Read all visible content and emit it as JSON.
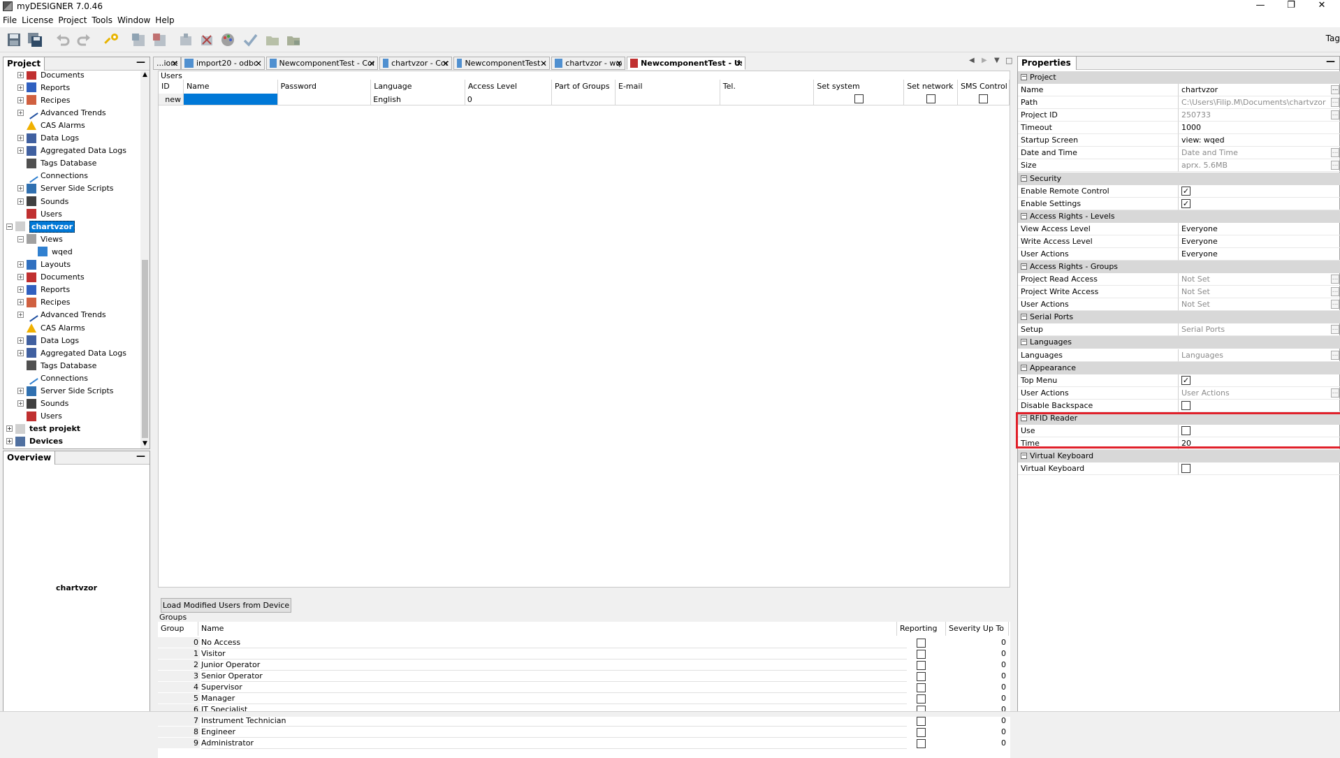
{
  "window": {
    "title": "myDESIGNER 7.0.46",
    "minimize": "—",
    "restore": "❐",
    "close": "✕"
  },
  "menu": [
    "File",
    "License",
    "Project",
    "Tools",
    "Window",
    "Help"
  ],
  "toolbar": {
    "tag_label": "Tag"
  },
  "project_panel": {
    "title": "Project",
    "minimize": "—",
    "items": [
      {
        "label": "Documents",
        "icon": "documents-icon"
      },
      {
        "label": "Reports",
        "icon": "reports-icon"
      },
      {
        "label": "Recipes",
        "icon": "recipes-icon"
      },
      {
        "label": "Advanced Trends",
        "icon": "trends-icon"
      },
      {
        "label": "CAS Alarms",
        "icon": "alarm-icon"
      },
      {
        "label": "Data Logs",
        "icon": "datalog-icon"
      },
      {
        "label": "Aggregated Data Logs",
        "icon": "datalog-icon"
      },
      {
        "label": "Tags Database",
        "icon": "tags-icon"
      },
      {
        "label": "Connections",
        "icon": "connections-icon"
      },
      {
        "label": "Server Side Scripts",
        "icon": "script-icon"
      },
      {
        "label": "Sounds",
        "icon": "sound-icon"
      },
      {
        "label": "Users",
        "icon": "users-icon"
      },
      {
        "label": "chartvzor",
        "icon": "project-icon"
      },
      {
        "label": "Views",
        "icon": "views-icon"
      },
      {
        "label": "wqed",
        "icon": "view-icon"
      },
      {
        "label": "Layouts",
        "icon": "layouts-icon"
      },
      {
        "label": "Documents",
        "icon": "documents-icon"
      },
      {
        "label": "Reports",
        "icon": "reports-icon"
      },
      {
        "label": "Recipes",
        "icon": "recipes-icon"
      },
      {
        "label": "Advanced Trends",
        "icon": "trends-icon"
      },
      {
        "label": "CAS Alarms",
        "icon": "alarm-icon"
      },
      {
        "label": "Data Logs",
        "icon": "datalog-icon"
      },
      {
        "label": "Aggregated Data Logs",
        "icon": "datalog-icon"
      },
      {
        "label": "Tags Database",
        "icon": "tags-icon"
      },
      {
        "label": "Connections",
        "icon": "connections-icon"
      },
      {
        "label": "Server Side Scripts",
        "icon": "script-icon"
      },
      {
        "label": "Sounds",
        "icon": "sound-icon"
      },
      {
        "label": "Users",
        "icon": "users-icon"
      },
      {
        "label": "test projekt",
        "icon": "project-icon"
      },
      {
        "label": "Devices",
        "icon": "devices-icon"
      }
    ]
  },
  "overview_panel": {
    "title": "Overview",
    "minimize": "—",
    "content": "chartvzor"
  },
  "tabs": [
    {
      "label": "...ions",
      "close": "✕"
    },
    {
      "label": "import20 - odbc",
      "close": "✕"
    },
    {
      "label": "NewcomponentTest - Connections",
      "close": "✕"
    },
    {
      "label": "chartvzor - Connections",
      "close": "✕"
    },
    {
      "label": "NewcomponentTest - testComponent",
      "close": "✕"
    },
    {
      "label": "chartvzor - wqed",
      "close": "✕"
    },
    {
      "label": "NewcomponentTest - Users",
      "close": "✕"
    }
  ],
  "tab_nav": {
    "left": "◀",
    "right": "▶",
    "menu": "▼",
    "max": "□"
  },
  "users": {
    "section_label": "Users",
    "columns": [
      "ID",
      "Name",
      "Password",
      "Language",
      "Access Level",
      "Part of Groups",
      "E-mail",
      "Tel.",
      "Set system",
      "Set network",
      "SMS Control"
    ],
    "row": {
      "id": "new",
      "name": "",
      "password": "",
      "language": "English",
      "access_level": "0",
      "groups": "",
      "email": "",
      "tel": ""
    }
  },
  "load_button": "Load Modified Users from Device",
  "groups": {
    "section_label": "Groups",
    "columns": [
      "Group",
      "Name",
      "Reporting",
      "Severity Up To"
    ],
    "rows": [
      {
        "group": "0",
        "name": "No Access",
        "severity": "0"
      },
      {
        "group": "1",
        "name": "Visitor",
        "severity": "0"
      },
      {
        "group": "2",
        "name": "Junior Operator",
        "severity": "0"
      },
      {
        "group": "3",
        "name": "Senior Operator",
        "severity": "0"
      },
      {
        "group": "4",
        "name": "Supervisor",
        "severity": "0"
      },
      {
        "group": "5",
        "name": "Manager",
        "severity": "0"
      },
      {
        "group": "6",
        "name": "IT Specialist",
        "severity": "0"
      },
      {
        "group": "7",
        "name": "Instrument Technician",
        "severity": "0"
      },
      {
        "group": "8",
        "name": "Engineer",
        "severity": "0"
      },
      {
        "group": "9",
        "name": "Administrator",
        "severity": "0"
      }
    ]
  },
  "properties": {
    "title": "Properties",
    "minimize": "—",
    "rows": [
      {
        "cat": "Project"
      },
      {
        "name": "Name",
        "value": "chartvzor",
        "dots": true
      },
      {
        "name": "Path",
        "value": "C:\\Users\\Filip.M\\Documents\\chartvzor",
        "gray": true,
        "dots": true
      },
      {
        "name": "Project ID",
        "value": "250733",
        "gray": true,
        "dots": true
      },
      {
        "name": "Timeout",
        "value": "1000"
      },
      {
        "name": "Startup Screen",
        "value": "view: wqed"
      },
      {
        "name": "Date and Time",
        "value": "Date and Time",
        "gray": true,
        "dots": true
      },
      {
        "name": "Size",
        "value": "aprx. 5.6MB",
        "gray": true,
        "dots": true
      },
      {
        "cat": "Security"
      },
      {
        "name": "Enable Remote Control",
        "check": true
      },
      {
        "name": "Enable Settings",
        "check": true
      },
      {
        "cat": "Access Rights - Levels"
      },
      {
        "name": "View Access Level",
        "value": "Everyone"
      },
      {
        "name": "Write Access Level",
        "value": "Everyone"
      },
      {
        "name": "User Actions",
        "value": "Everyone"
      },
      {
        "cat": "Access Rights - Groups"
      },
      {
        "name": "Project Read Access",
        "value": "Not Set",
        "gray": true,
        "dots": true
      },
      {
        "name": "Project Write Access",
        "value": "Not Set",
        "gray": true,
        "dots": true
      },
      {
        "name": "User Actions",
        "value": "Not Set",
        "gray": true,
        "dots": true
      },
      {
        "cat": "Serial Ports"
      },
      {
        "name": "Setup",
        "value": "Serial Ports",
        "gray": true,
        "dots": true
      },
      {
        "cat": "Languages"
      },
      {
        "name": "Languages",
        "value": "Languages",
        "gray": true,
        "dots": true
      },
      {
        "cat": "Appearance"
      },
      {
        "name": "Top Menu",
        "check": true
      },
      {
        "name": "User Actions",
        "value": "User Actions",
        "gray": true,
        "dots": true
      },
      {
        "name": "Disable Backspace",
        "check": false
      },
      {
        "cat": "RFID Reader"
      },
      {
        "name": "Use",
        "check": false
      },
      {
        "name": "Time",
        "value": "20"
      },
      {
        "cat": "Virtual Keyboard"
      },
      {
        "name": "Virtual Keyboard",
        "check": false
      }
    ]
  },
  "colors": {
    "highlight": "#e0202a",
    "selection": "#0078d7"
  }
}
